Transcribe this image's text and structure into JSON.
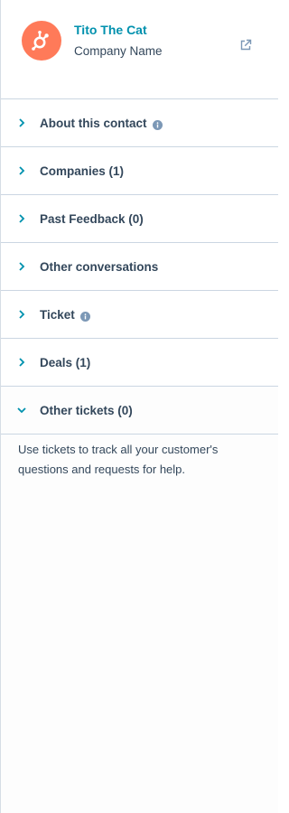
{
  "contact": {
    "name": "Tito The Cat",
    "company": "Company Name"
  },
  "colors": {
    "avatar": "#ff7a59",
    "link": "#0091ae",
    "text": "#33475b",
    "divider": "#cbd6e2"
  },
  "icons": {
    "avatar": "hubspot-sprocket-icon",
    "external": "external-link-icon",
    "collapsed": "chevron-right-icon",
    "expanded": "chevron-down-icon",
    "info": "info-icon"
  },
  "sections": [
    {
      "label": "About this contact",
      "info": true,
      "expanded": false
    },
    {
      "label": "Companies (1)",
      "info": false,
      "expanded": false
    },
    {
      "label": "Past Feedback (0)",
      "info": false,
      "expanded": false
    },
    {
      "label": "Other conversations",
      "info": false,
      "expanded": false
    },
    {
      "label": "Ticket",
      "info": true,
      "expanded": false
    },
    {
      "label": "Deals (1)",
      "info": false,
      "expanded": false
    },
    {
      "label": "Other tickets (0)",
      "info": false,
      "expanded": true
    }
  ],
  "other_tickets": {
    "helper_text": "Use tickets to track all your customer's questions and requests for help."
  }
}
